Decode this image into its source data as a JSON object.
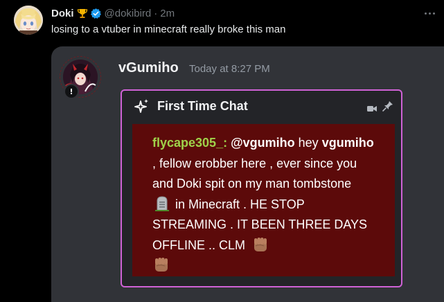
{
  "tweet": {
    "display_name": "Doki",
    "handle": "@dokibird",
    "separator": "·",
    "time": "2m",
    "text": "losing to a vtuber in minecraft really broke this man",
    "icons": [
      "trophy-icon",
      "verified-badge-icon",
      "more-options-icon"
    ]
  },
  "discord": {
    "username": "vGumiho",
    "timestamp": "Today at 8:27 PM",
    "embed": {
      "title": "First Time Chat",
      "accent_color": "#cf62d6",
      "icons": [
        "sparkle-icon",
        "camera-icon",
        "pin-icon"
      ]
    },
    "chat": {
      "username": "flycape305_",
      "colon": ":",
      "mention": "@vgumiho",
      "part1": " hey ",
      "bold_name": "vgumiho",
      "part2": " , fellow erobber here , ever since you and Doki spit on my man tombstone ",
      "part3": " in Minecraft . HE STOP STREAMING . IT BEEN THREE DAYS OFFLINE .. CLM ",
      "background": "#5c0a0a",
      "username_color": "#9fd24a"
    }
  }
}
